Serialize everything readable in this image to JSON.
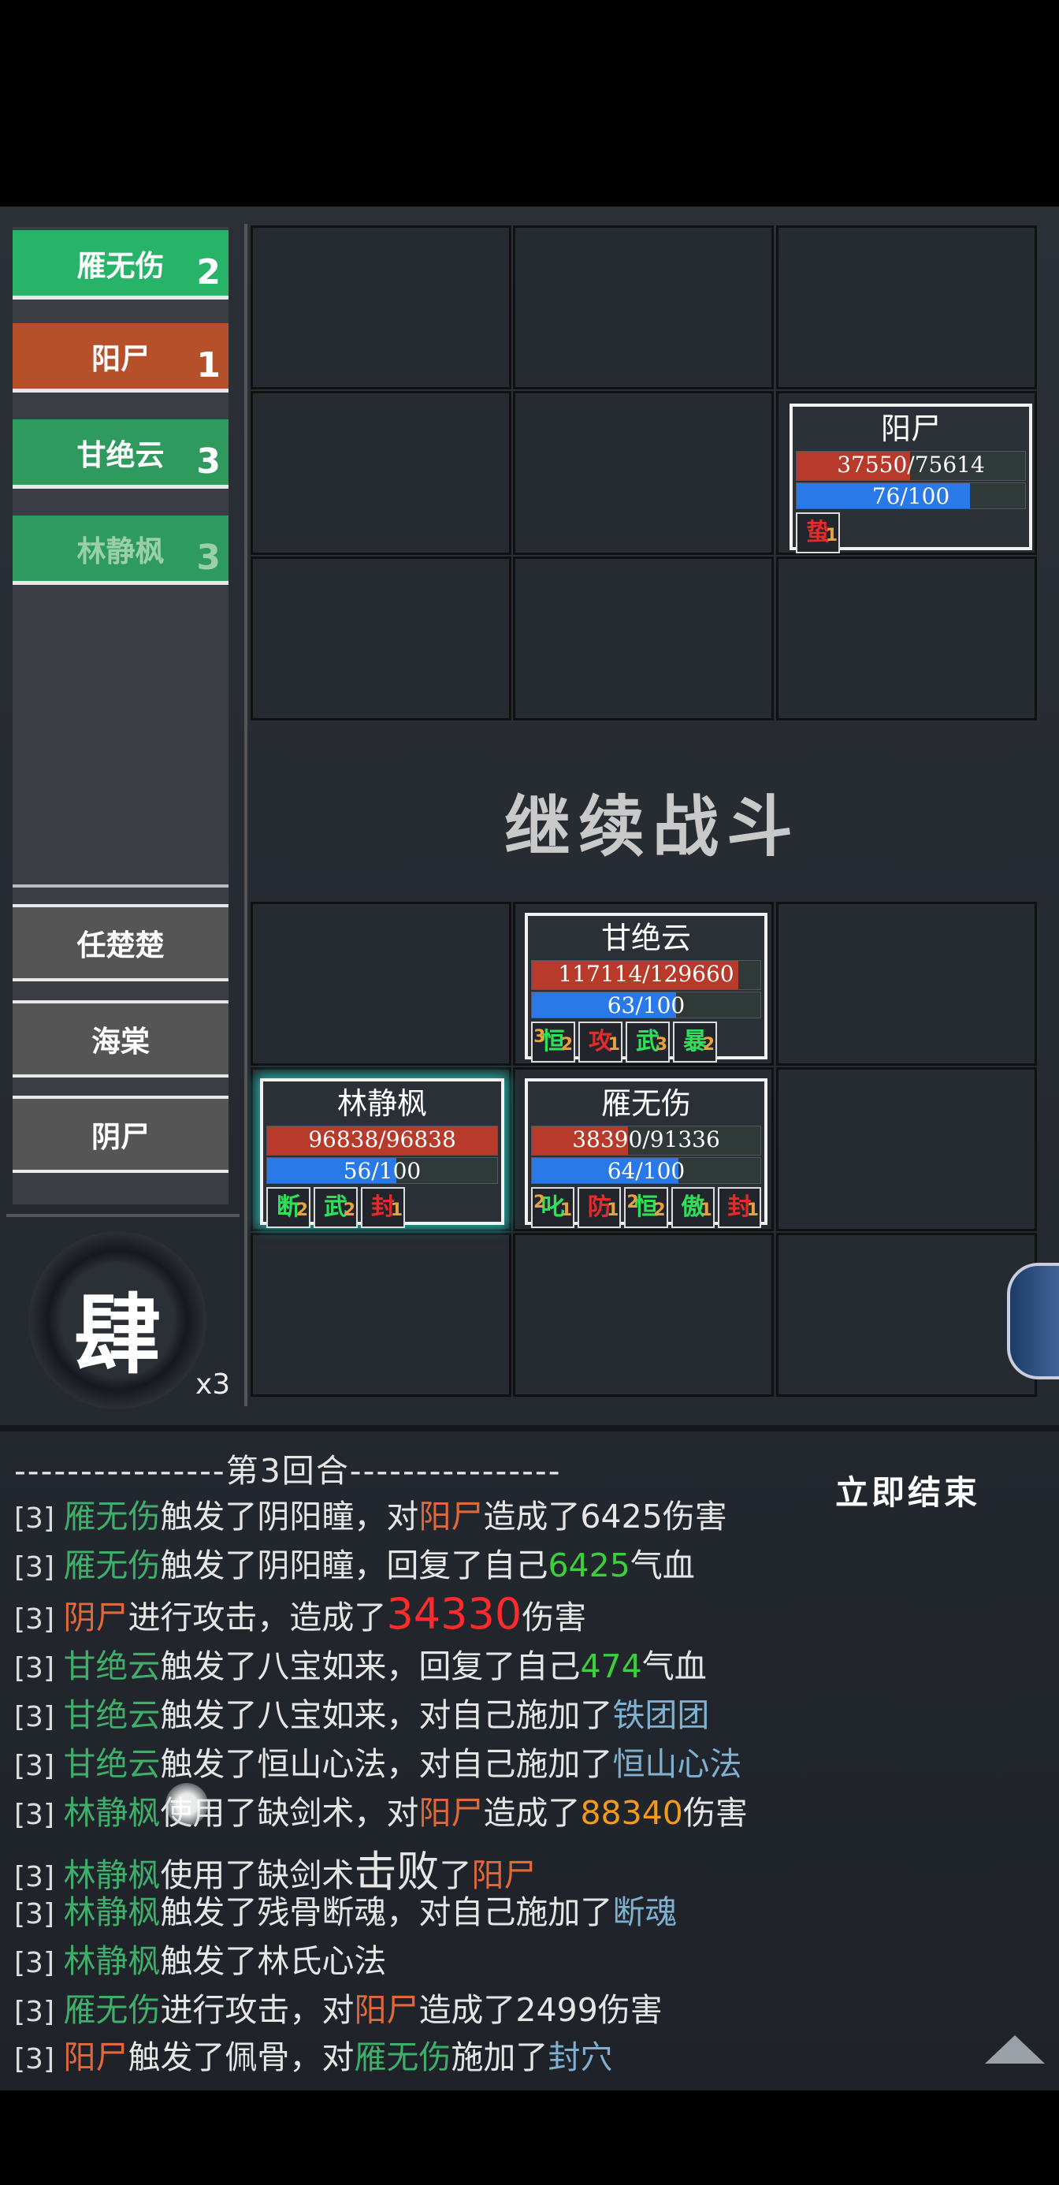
{
  "turn_order": [
    {
      "name": "雁无伤",
      "count": "2",
      "color": "#27b469"
    },
    {
      "name": "阳尸",
      "count": "1",
      "color": "#b5502a"
    },
    {
      "name": "甘绝云",
      "count": "3",
      "color": "#2e9a5e"
    },
    {
      "name": "林静枫",
      "count": "3",
      "color": "#2e9a5e"
    }
  ],
  "reserve": [
    "任楚楚",
    "海棠",
    "阴尸"
  ],
  "continue_label": "继续战斗",
  "skill": {
    "glyph": "肆",
    "count": "x3"
  },
  "enemy": {
    "name": "阳尸",
    "hp": "37550/75614",
    "hp_frac": 0.497,
    "mp": "76/100",
    "mp_frac": 0.76,
    "buffs": [
      {
        "label": "蛰",
        "stack": "1",
        "color": "#e22b2b"
      }
    ]
  },
  "allies": [
    {
      "name": "甘绝云",
      "hp": "117114/129660",
      "hp_frac": 0.903,
      "mp": "63/100",
      "mp_frac": 0.63,
      "buffs": [
        {
          "label": "恒",
          "stack": "2",
          "lstack": "3",
          "color": "#2ee05a"
        },
        {
          "label": "攻",
          "stack": "1",
          "color": "#e22b2b"
        },
        {
          "label": "武",
          "stack": "3",
          "color": "#2ee05a"
        },
        {
          "label": "暴",
          "stack": "2",
          "color": "#2ee05a"
        }
      ]
    },
    {
      "name": "林静枫",
      "hp": "96838/96838",
      "hp_frac": 1.0,
      "mp": "56/100",
      "mp_frac": 0.56,
      "buffs": [
        {
          "label": "断",
          "stack": "2",
          "color": "#2ee05a"
        },
        {
          "label": "武",
          "stack": "2",
          "color": "#2ee05a"
        },
        {
          "label": "封",
          "stack": "1",
          "color": "#e22b2b"
        }
      ]
    },
    {
      "name": "雁无伤",
      "hp": "38390/91336",
      "hp_frac": 0.42,
      "mp": "64/100",
      "mp_frac": 0.64,
      "buffs": [
        {
          "label": "叱",
          "stack": "1",
          "lstack": "2",
          "color": "#2ee05a"
        },
        {
          "label": "防",
          "stack": "1",
          "color": "#e22b2b"
        },
        {
          "label": "恒",
          "stack": "2",
          "lstack": "2",
          "color": "#2ee05a"
        },
        {
          "label": "傲",
          "stack": "1",
          "color": "#2ee05a"
        },
        {
          "label": "封",
          "stack": "1",
          "color": "#e22b2b"
        }
      ]
    }
  ],
  "log": {
    "round_header": "----------------第3回合----------------",
    "end_now": "立即结束",
    "lines": [
      [
        [
          "[3] ",
          "tag"
        ],
        [
          "雁无伤",
          "c-green"
        ],
        [
          "触发了阴阳瞳，对",
          ""
        ],
        [
          "阳尸",
          "c-orange"
        ],
        [
          "造成了6425伤害",
          ""
        ]
      ],
      [
        [
          "[3] ",
          "tag"
        ],
        [
          "雁无伤",
          "c-green"
        ],
        [
          "触发了阴阳瞳，回复了自己",
          ""
        ],
        [
          "6425",
          "c-lg"
        ],
        [
          "气血",
          ""
        ]
      ],
      [
        [
          "[3] ",
          "tag"
        ],
        [
          "阴尸",
          "c-orange"
        ],
        [
          "进行攻击，造成了",
          ""
        ],
        [
          "34330",
          "c-red big"
        ],
        [
          "伤害",
          ""
        ]
      ],
      [
        [
          "[3] ",
          "tag"
        ],
        [
          "甘绝云",
          "c-green"
        ],
        [
          "触发了八宝如来，回复了自己",
          ""
        ],
        [
          "474",
          "c-lg"
        ],
        [
          "气血",
          ""
        ]
      ],
      [
        [
          "[3] ",
          "tag"
        ],
        [
          "甘绝云",
          "c-green"
        ],
        [
          "触发了八宝如来，对自己施加了",
          ""
        ],
        [
          "铁团团",
          "c-blue"
        ]
      ],
      [
        [
          "[3] ",
          "tag"
        ],
        [
          "甘绝云",
          "c-green"
        ],
        [
          "触发了恒山心法，对自己施加了",
          ""
        ],
        [
          "恒山心法",
          "c-blue"
        ]
      ],
      [
        [
          "[3] ",
          "tag"
        ],
        [
          "林静枫",
          "c-green"
        ],
        [
          "使用了缺剑术，对",
          ""
        ],
        [
          "阳尸",
          "c-orange"
        ],
        [
          "造成了",
          ""
        ],
        [
          "88340",
          "c-yel"
        ],
        [
          "伤害",
          ""
        ]
      ],
      [
        [
          "[3] ",
          "tag"
        ],
        [
          "林静枫",
          "c-green"
        ],
        [
          "使用了缺剑术",
          ""
        ],
        [
          "击败",
          "big"
        ],
        [
          "了",
          ""
        ],
        [
          "阳尸",
          "c-orange"
        ]
      ],
      [
        [
          "[3] ",
          "tag"
        ],
        [
          "林静枫",
          "c-green"
        ],
        [
          "触发了残骨断魂，对自己施加了",
          ""
        ],
        [
          "断魂",
          "c-blue"
        ]
      ],
      [
        [
          "[3] ",
          "tag"
        ],
        [
          "林静枫",
          "c-green"
        ],
        [
          "触发了林氏心法",
          ""
        ]
      ],
      [
        [
          "[3] ",
          "tag"
        ],
        [
          "雁无伤",
          "c-green"
        ],
        [
          "进行攻击，对",
          ""
        ],
        [
          "阳尸",
          "c-orange"
        ],
        [
          "造成了2499伤害",
          ""
        ]
      ],
      [
        [
          "[3] ",
          "tag"
        ],
        [
          "阳尸",
          "c-orange"
        ],
        [
          "触发了佩骨，对",
          ""
        ],
        [
          "雁无伤",
          "c-green"
        ],
        [
          "施加了",
          ""
        ],
        [
          "封穴",
          "c-blue"
        ]
      ]
    ]
  }
}
